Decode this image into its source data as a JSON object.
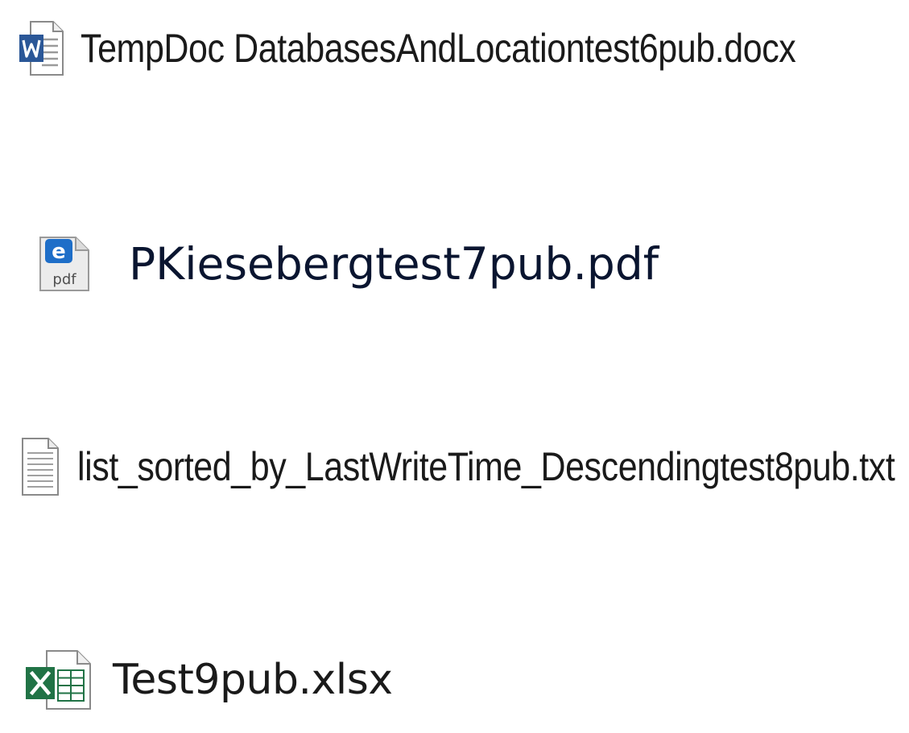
{
  "files": [
    {
      "name": "TempDoc DatabasesAndLocationtest6pub.docx",
      "icon": "word-document-icon",
      "accent": "#2b5797"
    },
    {
      "name": "PKiesebergtest7pub.pdf",
      "icon": "pdf-edge-document-icon",
      "accent": "#1e6ec8",
      "icon_label": "pdf",
      "icon_letter": "e"
    },
    {
      "name": "list_sorted_by_LastWriteTime_Descendingtest8pub.txt",
      "icon": "text-document-icon",
      "accent": "#8c8c8c"
    },
    {
      "name": "Test9pub.xlsx",
      "icon": "excel-workbook-icon",
      "accent": "#217346"
    }
  ]
}
